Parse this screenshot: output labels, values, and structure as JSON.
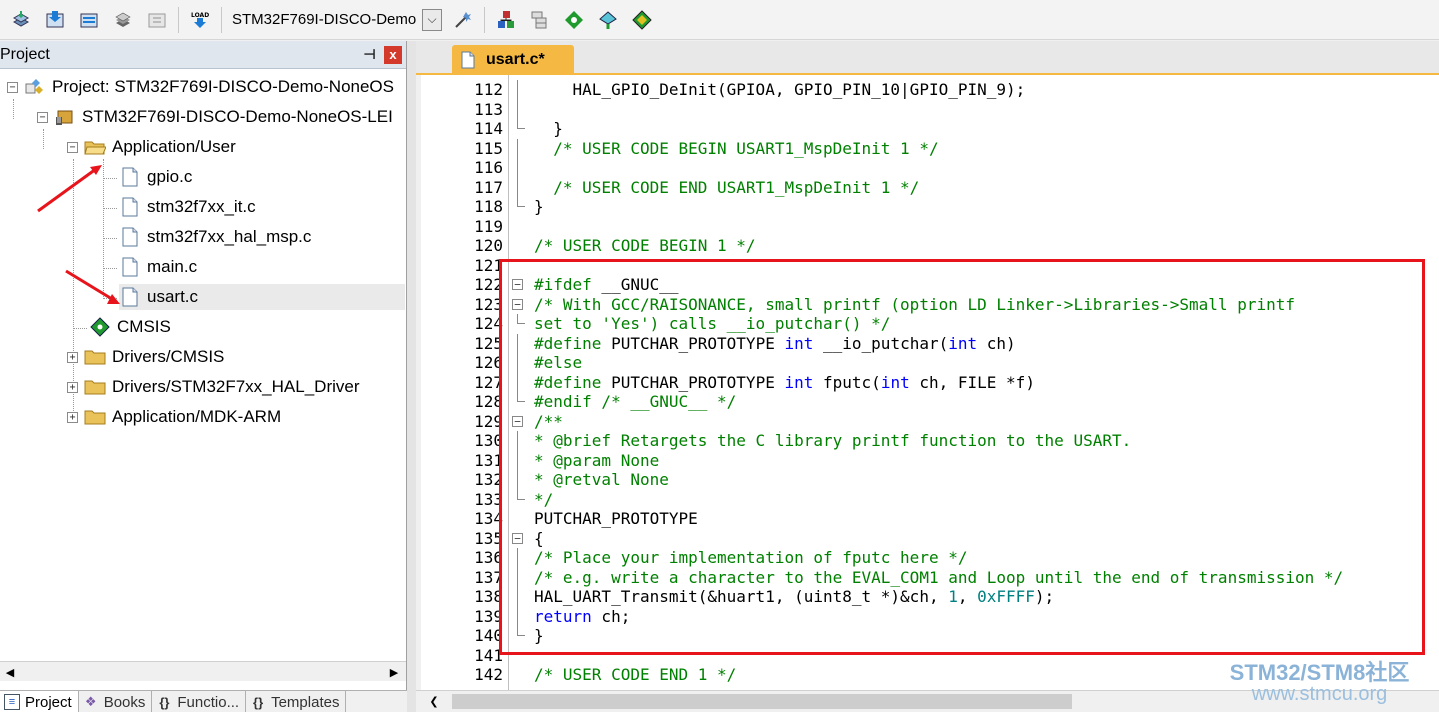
{
  "toolbar": {
    "target_name": "STM32F769I-DISCO-Demo",
    "buttons": [
      "translate-icon",
      "build-icon",
      "rebuild-icon",
      "batch-build-icon",
      "stop-build-icon",
      "load-icon",
      "target-options-icon",
      "file-extensions-icon",
      "manage-project-icon",
      "pack-installer-icon",
      "runtime-env-icon",
      "select-software-packs-icon"
    ]
  },
  "project_pane": {
    "title": "Project",
    "pin_label": "ᵖ",
    "close_label": "x",
    "tree": {
      "project_root": "Project: STM32F769I-DISCO-Demo-NoneOS",
      "target": "STM32F769I-DISCO-Demo-NoneOS-LEI",
      "group_app_user": "Application/User",
      "files": [
        "gpio.c",
        "stm32f7xx_it.c",
        "stm32f7xx_hal_msp.c",
        "main.c",
        "usart.c"
      ],
      "cmsis": "CMSIS",
      "group_drivers_cmsis": "Drivers/CMSIS",
      "group_drivers_hal": "Drivers/STM32F7xx_HAL_Driver",
      "group_app_mdk": "Application/MDK-ARM"
    },
    "bottom_tabs": [
      {
        "label": "Project",
        "icon": "E"
      },
      {
        "label": "Books",
        "icon": "B"
      },
      {
        "label": "Functio...",
        "icon": "{}"
      },
      {
        "label": "Templates",
        "icon": "0"
      }
    ]
  },
  "editor": {
    "tab_label": "usart.c*",
    "lines": [
      {
        "n": "112",
        "t": "    HAL_GPIO_DeInit(GPIOA, GPIO_PIN_10|GPIO_PIN_9);"
      },
      {
        "n": "113",
        "t": ""
      },
      {
        "n": "114",
        "t": "  }"
      },
      {
        "n": "115",
        "t": "  /* USER CODE BEGIN USART1_MspDeInit 1 */"
      },
      {
        "n": "116",
        "t": ""
      },
      {
        "n": "117",
        "t": "  /* USER CODE END USART1_MspDeInit 1 */"
      },
      {
        "n": "118",
        "t": "}"
      },
      {
        "n": "119",
        "t": ""
      },
      {
        "n": "120",
        "t": "/* USER CODE BEGIN 1 */"
      },
      {
        "n": "121",
        "t": ""
      },
      {
        "n": "122",
        "t": "#ifdef __GNUC__"
      },
      {
        "n": "123",
        "t": "/* With GCC/RAISONANCE, small printf (option LD Linker->Libraries->Small printf"
      },
      {
        "n": "124",
        "t": "set to 'Yes') calls __io_putchar() */"
      },
      {
        "n": "125",
        "t": "#define PUTCHAR_PROTOTYPE int __io_putchar(int ch)"
      },
      {
        "n": "126",
        "t": "#else"
      },
      {
        "n": "127",
        "t": "#define PUTCHAR_PROTOTYPE int fputc(int ch, FILE *f)"
      },
      {
        "n": "128",
        "t": "#endif /* __GNUC__ */"
      },
      {
        "n": "129",
        "t": "/**"
      },
      {
        "n": "130",
        "t": "* @brief Retargets the C library printf function to the USART."
      },
      {
        "n": "131",
        "t": "* @param None"
      },
      {
        "n": "132",
        "t": "* @retval None"
      },
      {
        "n": "133",
        "t": "*/"
      },
      {
        "n": "134",
        "t": "PUTCHAR_PROTOTYPE"
      },
      {
        "n": "135",
        "t": "{"
      },
      {
        "n": "136",
        "t": "/* Place your implementation of fputc here */"
      },
      {
        "n": "137",
        "t": "/* e.g. write a character to the EVAL_COM1 and Loop until the end of transmission */"
      },
      {
        "n": "138",
        "t": "HAL_UART_Transmit(&huart1, (uint8_t *)&ch, 1, 0xFFFF);"
      },
      {
        "n": "139",
        "t": "return ch;"
      },
      {
        "n": "140",
        "t": "}"
      },
      {
        "n": "141",
        "t": ""
      },
      {
        "n": "142",
        "t": "/* USER CODE END 1 */"
      }
    ]
  },
  "watermark": {
    "brand": "STM32/STM8社区",
    "url": "www.stmcu.org"
  },
  "colors": {
    "tab_active": "#f5b943",
    "highlight_box": "#e8141b",
    "comment": "#008000",
    "keyword": "#0000ff",
    "arrow": "#e8141b"
  }
}
